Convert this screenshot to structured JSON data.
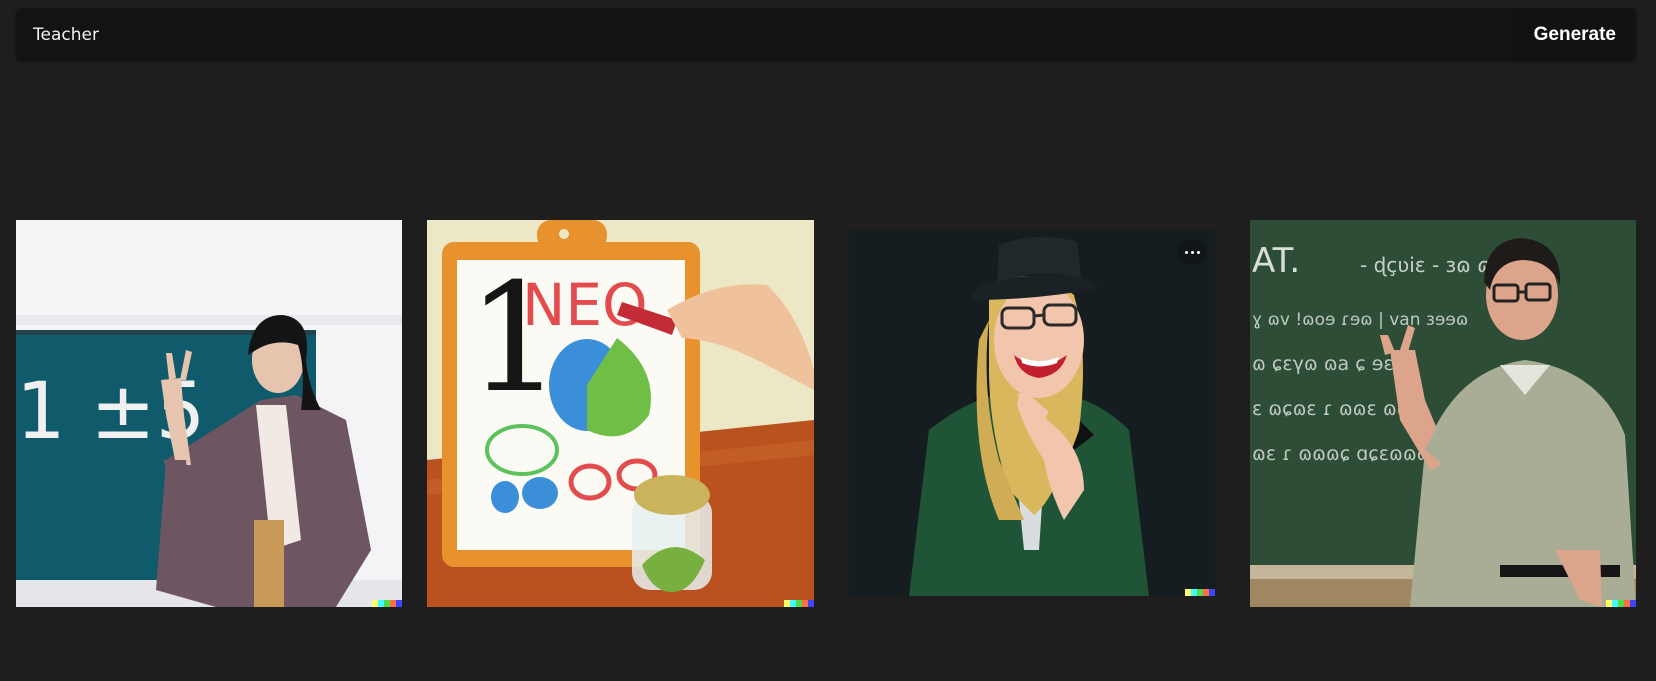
{
  "prompt": {
    "value": "Teacher",
    "generate_label": "Generate"
  },
  "results": [
    {
      "chalk_text": "1 ±5",
      "icon": "image-thumbnail"
    },
    {
      "board_text": "1NEO",
      "icon": "image-thumbnail"
    },
    {
      "icon": "image-thumbnail",
      "has_more_menu": true
    },
    {
      "chalk_lines": [
        "AT. - ɖçʋiɛ - ɜɷ ɷ",
        "ɣ ɷv !ɷoɘ ɾɘɷ | van ɜɘɘɷ",
        "ɷ ɕɛγɷ ɷa ɕ ɘɛ ɷ",
        "ɛ ɷɕɷɛ ɾ ɷɷɛ ɷɷɛ",
        "ɷɛ ɾ ɷɷɷɕ ɑɕɛɷɷɷɛ"
      ],
      "icon": "image-thumbnail"
    }
  ],
  "colors": {
    "background": "#1e1e1e",
    "bar": "#131313",
    "watermark": [
      "#ffff66",
      "#42ffff",
      "#51da4c",
      "#ff6e3c",
      "#3c46ff"
    ]
  }
}
